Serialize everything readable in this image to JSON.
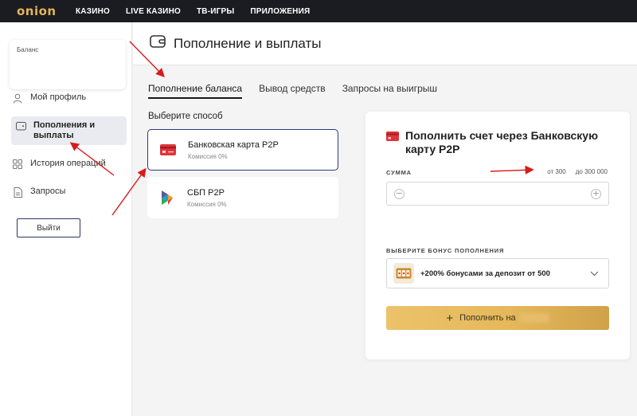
{
  "header": {
    "logo": "onion",
    "nav": [
      "КАЗИНО",
      "LIVE КАЗИНО",
      "ТВ-ИГРЫ",
      "ПРИЛОЖЕНИЯ"
    ]
  },
  "sidebar": {
    "balance_label": "Баланс",
    "items": [
      {
        "label": "Мой профиль",
        "icon": "user-icon"
      },
      {
        "label": "Пополнения и выплаты",
        "icon": "wallet-icon",
        "active": true
      },
      {
        "label": "История операций",
        "icon": "grid-icon"
      },
      {
        "label": "Запросы",
        "icon": "document-icon"
      }
    ],
    "logout_label": "Выйти"
  },
  "page": {
    "title": "Пополнение и выплаты",
    "tabs": [
      {
        "label": "Пополнение баланса",
        "active": true
      },
      {
        "label": "Вывод средств"
      },
      {
        "label": "Запросы на выигрыш"
      }
    ],
    "choose_label": "Выберите способ",
    "methods": [
      {
        "name": "Банковская карта P2P",
        "fee": "Комиссия 0%",
        "icon": "bank-card-icon",
        "selected": true
      },
      {
        "name": "СБП P2P",
        "fee": "Комиссия 0%",
        "icon": "sbp-logo-icon"
      }
    ]
  },
  "panel": {
    "title": "Пополнить счет через Банковскую карту P2P",
    "amount_label": "СУММА",
    "min": "от 300",
    "max": "до 300 000",
    "bonus_label": "ВЫБЕРИТЕ БОНУС ПОПОЛНЕНИЯ",
    "bonus_text": "+200% бонусами за депозит от 500",
    "submit_label": "Пополнить на"
  },
  "colors": {
    "topbar": "#1b1c21",
    "logo": "#e3b55a",
    "accent_gold": "#e5b85a",
    "selected_border": "#2c3a78",
    "annotation_red": "#d81b1b"
  }
}
